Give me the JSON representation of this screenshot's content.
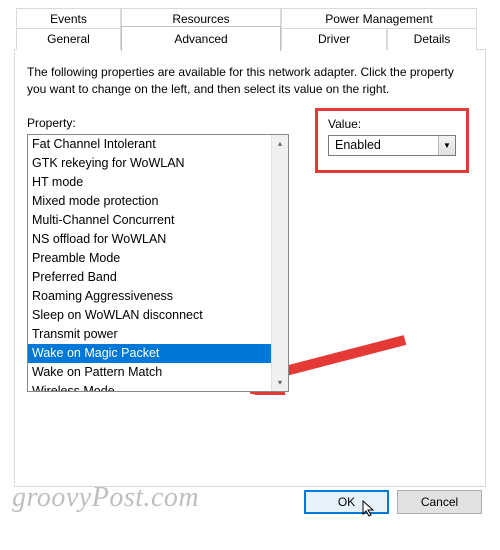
{
  "tabs": {
    "row1": [
      "Events",
      "Resources",
      "Power Management"
    ],
    "row2": [
      "General",
      "Advanced",
      "Driver",
      "Details"
    ],
    "active": "Advanced"
  },
  "description": "The following properties are available for this network adapter. Click the property you want to change on the left, and then select its value on the right.",
  "property_label": "Property:",
  "value_label": "Value:",
  "properties": [
    "Fat Channel Intolerant",
    "GTK rekeying for WoWLAN",
    "HT mode",
    "Mixed mode protection",
    "Multi-Channel Concurrent",
    "NS offload for WoWLAN",
    "Preamble Mode",
    "Preferred Band",
    "Roaming Aggressiveness",
    "Sleep on WoWLAN disconnect",
    "Transmit power",
    "Wake on Magic Packet",
    "Wake on Pattern Match",
    "Wireless Mode"
  ],
  "selected_property": "Wake on Magic Packet",
  "value_selected": "Enabled",
  "buttons": {
    "ok": "OK",
    "cancel": "Cancel"
  },
  "watermark": "groovyPost.com",
  "colors": {
    "highlight_border": "#e53935",
    "selection_bg": "#0078d7",
    "arrow_fill": "#e53935"
  }
}
